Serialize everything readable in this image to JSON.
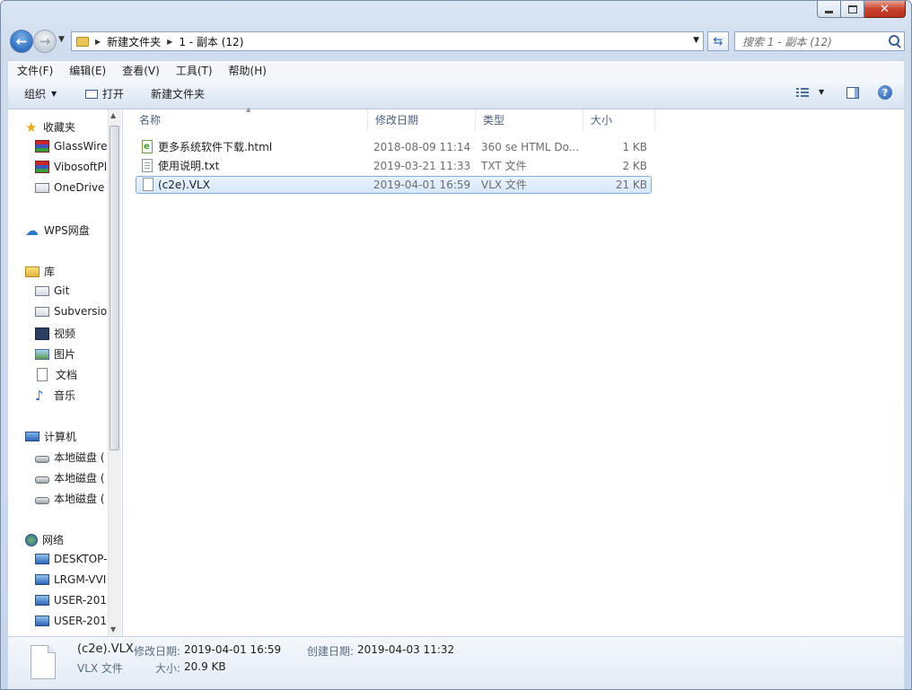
{
  "window": {
    "controls": {
      "minimize": "—",
      "maximize": "□",
      "close": "✕"
    }
  },
  "address": {
    "crumbs": [
      "新建文件夹",
      "1 - 副本 (12)"
    ],
    "search_placeholder": "搜索 1 - 副本 (12)"
  },
  "menubar": [
    "文件(F)",
    "编辑(E)",
    "查看(V)",
    "工具(T)",
    "帮助(H)"
  ],
  "toolbar": {
    "organize": "组织",
    "open": "打开",
    "new_folder": "新建文件夹"
  },
  "nav": {
    "favorites": {
      "label": "收藏夹",
      "items": [
        "GlassWire",
        "VibosoftPl",
        "OneDrive"
      ]
    },
    "wps": "WPS网盘",
    "libraries": {
      "label": "库",
      "items": [
        "Git",
        "Subversio",
        "视频",
        "图片",
        "文档",
        "音乐"
      ]
    },
    "computer": {
      "label": "计算机",
      "items": [
        "本地磁盘 (",
        "本地磁盘 (",
        "本地磁盘 ("
      ]
    },
    "network": {
      "label": "网络",
      "items": [
        "DESKTOP-",
        "LRGM-VVI",
        "USER-201",
        "USER-201"
      ]
    }
  },
  "columns": {
    "name": "名称",
    "modified": "修改日期",
    "type": "类型",
    "size": "大小"
  },
  "files": [
    {
      "name": "更多系统软件下载.html",
      "modified": "2018-08-09 11:14",
      "type": "360 se HTML Do...",
      "size": "1 KB",
      "icon": "html-file-icon"
    },
    {
      "name": "使用说明.txt",
      "modified": "2019-03-21 11:33",
      "type": "TXT 文件",
      "size": "2 KB",
      "icon": "text-file-icon"
    },
    {
      "name": "(c2e).VLX",
      "modified": "2019-04-01 16:59",
      "type": "VLX 文件",
      "size": "21 KB",
      "icon": "blank-file-icon",
      "selected": true
    }
  ],
  "details": {
    "name": "(c2e).VLX",
    "type": "VLX 文件",
    "modified_label": "修改日期:",
    "modified": "2019-04-01 16:59",
    "created_label": "创建日期:",
    "created": "2019-04-03 11:32",
    "size_label": "大小:",
    "size": "20.9 KB"
  }
}
